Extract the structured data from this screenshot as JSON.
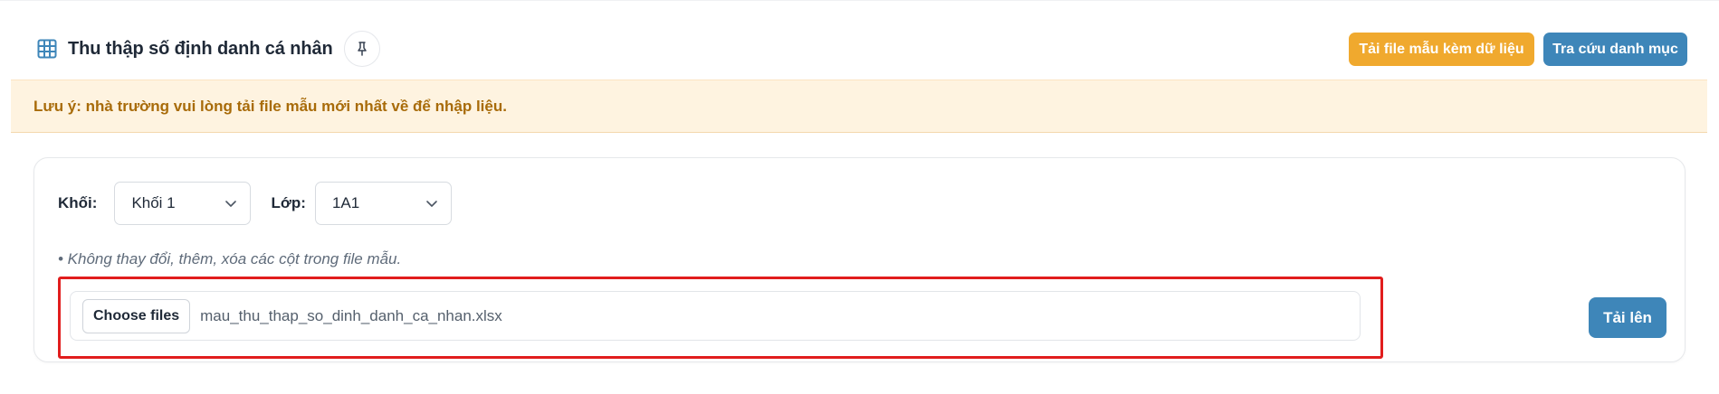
{
  "header": {
    "title": "Thu thập số định danh cá nhân",
    "title_icon": "table-grid-icon",
    "pin_icon": "pin-icon",
    "download_template_label": "Tải file mẫu kèm dữ liệu",
    "lookup_label": "Tra cứu danh mục"
  },
  "notice": {
    "text": "Lưu ý: nhà trường vui lòng tải file mẫu mới nhất về để nhập liệu."
  },
  "filters": {
    "khoi_label": "Khối:",
    "khoi_value": "Khối 1",
    "lop_label": "Lớp:",
    "lop_value": "1A1"
  },
  "hint": "• Không thay đổi, thêm, xóa các cột trong file mẫu.",
  "upload": {
    "choose_label": "Choose files",
    "file_name": "mau_thu_thap_so_dinh_danh_ca_nhan.xlsx",
    "submit_label": "Tải lên"
  },
  "colors": {
    "accent_orange": "#f0a92e",
    "accent_blue": "#3e86b9",
    "notice_bg": "#fef3e0",
    "notice_text": "#a86b09",
    "highlight_red": "#e11d1d"
  }
}
